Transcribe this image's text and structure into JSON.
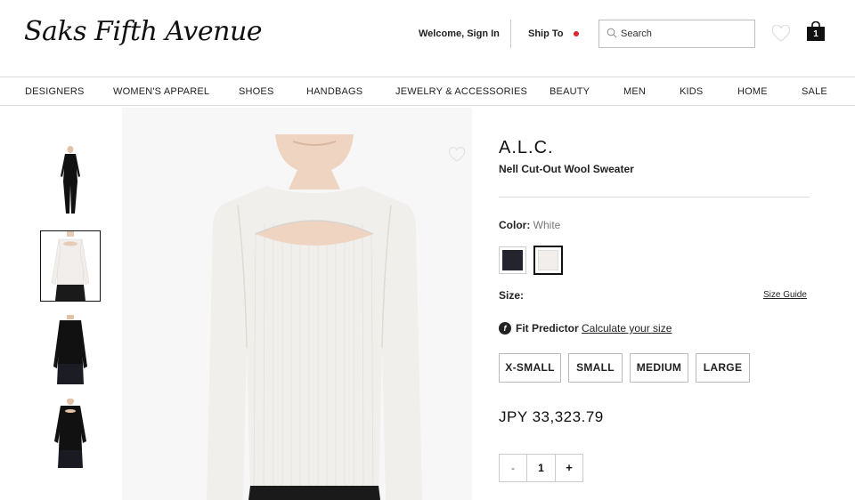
{
  "header": {
    "logo": "Saks Fifth Avenue",
    "welcome": "Welcome, Sign In",
    "ship_to": "Ship To",
    "search_placeholder": "Search",
    "bag_count": "1",
    "ship_dot_color": "#e0262f"
  },
  "nav": {
    "items": [
      "DESIGNERS",
      "WOMEN'S APPAREL",
      "SHOES",
      "HANDBAGS",
      "JEWELRY & ACCESSORIES",
      "BEAUTY",
      "MEN",
      "KIDS",
      "HOME",
      "SALE"
    ]
  },
  "product": {
    "brand": "A.L.C.",
    "name": "Nell Cut-Out Wool Sweater",
    "color_label": "Color:",
    "color_value": "White",
    "swatches": [
      {
        "name": "black",
        "color": "#24242f",
        "selected": false
      },
      {
        "name": "white",
        "color": "#f1eeeb",
        "selected": true
      }
    ],
    "size_label": "Size:",
    "size_guide": "Size Guide",
    "fit_predictor": "Fit Predictor",
    "fit_link": "Calculate your size",
    "sizes": [
      "X-SMALL",
      "SMALL",
      "MEDIUM",
      "LARGE"
    ],
    "price": "JPY 33,323.79",
    "quantity": {
      "minus": "-",
      "value": "1",
      "plus": "+"
    }
  },
  "thumbnails": [
    {
      "variant": "black-full",
      "selected": false
    },
    {
      "variant": "white-top",
      "selected": true
    },
    {
      "variant": "black-top",
      "selected": false
    },
    {
      "variant": "black-cutout",
      "selected": false
    }
  ],
  "icons": [
    "search-icon",
    "heart-icon",
    "shopping-bag-icon",
    "fit-predictor-icon"
  ]
}
